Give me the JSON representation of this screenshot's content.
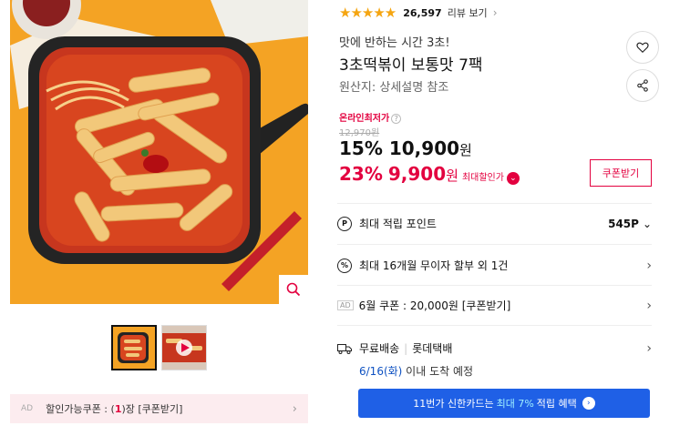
{
  "gallery": {
    "zoom_icon": "magnifier-icon",
    "thumbnails": [
      "product-photo",
      "video-preview"
    ]
  },
  "coupon_bar": {
    "ad": "AD",
    "prefix": "할인가능쿠폰 : (",
    "count": "1",
    "suffix": ")장 [쿠폰받기]"
  },
  "rating": {
    "stars": 4.5,
    "stars_text": "★★★★★",
    "review_count": "26,597",
    "review_link": "리뷰 보기"
  },
  "product": {
    "subtitle": "맛에 반하는 시간 3초!",
    "title": "3초떡볶이 보통맛 7팩",
    "origin": "원산지:  상세설명 참조"
  },
  "price": {
    "lowest_label": "온라인최저가",
    "original": "12,970원",
    "discount_pct": "15%",
    "discount_price": "10,900",
    "won": "원",
    "max_pct": "23%",
    "max_price": "9,900",
    "max_label": "최대할인가",
    "coupon_button": "쿠폰받기"
  },
  "benefits": {
    "points_label": "최대 적립 포인트",
    "points_value": "545P",
    "installment": "최대 16개월 무이자 할부 외 1건",
    "ad": "AD",
    "june_coupon": "6월 쿠폰 : 20,000원 [쿠폰받기]"
  },
  "shipping": {
    "free": "무료배송",
    "carrier": "롯데택배",
    "date": "6/16(화)",
    "arrival": " 이내 도착 예정"
  },
  "card_banner": {
    "prefix": "11번가 신한카드는",
    "highlight": "최대 7%",
    "suffix": "적립 혜택"
  },
  "colors": {
    "accent": "#e3003f",
    "blue": "#1f60e6",
    "star": "#f5a511"
  }
}
